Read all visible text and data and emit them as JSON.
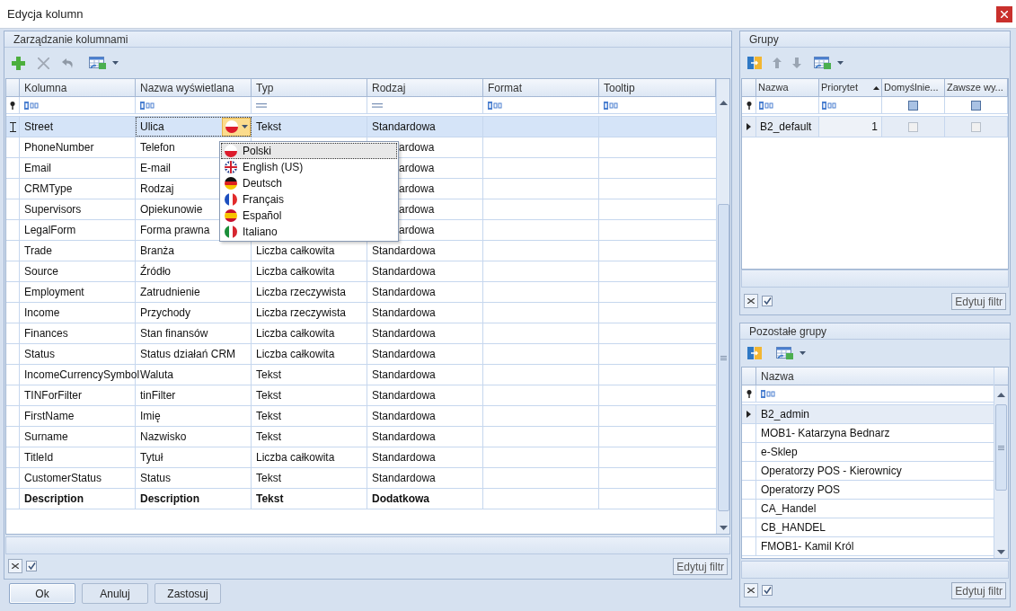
{
  "window": {
    "title": "Edycja kolumn"
  },
  "columns_panel": {
    "title": "Zarządzanie kolumnami",
    "columns": [
      {
        "label": "Kolumna",
        "kind": "text"
      },
      {
        "label": "Nazwa wyświetlana",
        "kind": "text"
      },
      {
        "label": "Typ",
        "kind": "equals"
      },
      {
        "label": "Rodzaj",
        "kind": "equals"
      },
      {
        "label": "Format",
        "kind": "text"
      },
      {
        "label": "Tooltip",
        "kind": "text"
      }
    ],
    "rows": [
      {
        "kolumna": "Street",
        "nazwa": "Ulica",
        "typ": "Tekst",
        "rodzaj": "Standardowa",
        "selected": true,
        "editing": true,
        "kind": "standard"
      },
      {
        "kolumna": "PhoneNumber",
        "nazwa": "Telefon",
        "rodzaj": "ardowa",
        "selected": false,
        "editing": false,
        "kind": "standard"
      },
      {
        "kolumna": "Email",
        "nazwa": "E-mail",
        "rodzaj": "ardowa",
        "selected": false,
        "editing": false,
        "kind": "standard"
      },
      {
        "kolumna": "CRMType",
        "nazwa": "Rodzaj",
        "rodzaj": "ardowa",
        "selected": false,
        "editing": false,
        "kind": "standard"
      },
      {
        "kolumna": "Supervisors",
        "nazwa": "Opiekunowie",
        "rodzaj": "ardowa",
        "selected": false,
        "editing": false,
        "kind": "standard"
      },
      {
        "kolumna": "LegalForm",
        "nazwa": "Forma prawna",
        "rodzaj": "ardowa",
        "selected": false,
        "editing": false,
        "kind": "standard"
      },
      {
        "kolumna": "Trade",
        "nazwa": "Branża",
        "typ": "Liczba całkowita",
        "rodzaj": "Standardowa",
        "selected": false,
        "editing": false,
        "kind": "standard"
      },
      {
        "kolumna": "Source",
        "nazwa": "Źródło",
        "typ": "Liczba całkowita",
        "rodzaj": "Standardowa",
        "selected": false,
        "editing": false,
        "kind": "standard"
      },
      {
        "kolumna": "Employment",
        "nazwa": "Zatrudnienie",
        "typ": "Liczba rzeczywista",
        "rodzaj": "Standardowa",
        "selected": false,
        "editing": false,
        "kind": "standard"
      },
      {
        "kolumna": "Income",
        "nazwa": "Przychody",
        "typ": "Liczba rzeczywista",
        "rodzaj": "Standardowa",
        "selected": false,
        "editing": false,
        "kind": "standard"
      },
      {
        "kolumna": "Finances",
        "nazwa": "Stan finansów",
        "typ": "Liczba całkowita",
        "rodzaj": "Standardowa",
        "selected": false,
        "editing": false,
        "kind": "standard"
      },
      {
        "kolumna": "Status",
        "nazwa": "Status działań CRM",
        "typ": "Liczba całkowita",
        "rodzaj": "Standardowa",
        "selected": false,
        "editing": false,
        "kind": "standard"
      },
      {
        "kolumna": "IncomeCurrencySymbol",
        "nazwa": "Waluta",
        "typ": "Tekst",
        "rodzaj": "Standardowa",
        "selected": false,
        "editing": false,
        "kind": "standard"
      },
      {
        "kolumna": "TINForFilter",
        "nazwa": "tinFilter",
        "typ": "Tekst",
        "rodzaj": "Standardowa",
        "selected": false,
        "editing": false,
        "kind": "standard"
      },
      {
        "kolumna": "FirstName",
        "nazwa": "Imię",
        "typ": "Tekst",
        "rodzaj": "Standardowa",
        "selected": false,
        "editing": false,
        "kind": "standard"
      },
      {
        "kolumna": "Surname",
        "nazwa": "Nazwisko",
        "typ": "Tekst",
        "rodzaj": "Standardowa",
        "selected": false,
        "editing": false,
        "kind": "standard"
      },
      {
        "kolumna": "TitleId",
        "nazwa": "Tytuł",
        "typ": "Liczba całkowita",
        "rodzaj": "Standardowa",
        "selected": false,
        "editing": false,
        "kind": "standard"
      },
      {
        "kolumna": "CustomerStatus",
        "nazwa": "Status",
        "typ": "Tekst",
        "rodzaj": "Standardowa",
        "selected": false,
        "editing": false,
        "kind": "standard"
      },
      {
        "kolumna": "Description",
        "nazwa": "Description",
        "typ": "Tekst",
        "rodzaj": "Dodatkowa",
        "selected": false,
        "editing": false,
        "kind": "custom"
      }
    ],
    "language_menu": {
      "items": [
        {
          "label": "Polski",
          "kind": "pl",
          "selected": true
        },
        {
          "label": "English (US)",
          "kind": "gb",
          "selected": false
        },
        {
          "label": "Deutsch",
          "kind": "de",
          "selected": false
        },
        {
          "label": "Français",
          "kind": "fr",
          "selected": false
        },
        {
          "label": "Español",
          "kind": "es",
          "selected": false
        },
        {
          "label": "Italiano",
          "kind": "it",
          "selected": false
        }
      ]
    },
    "filter_bar": {
      "checked": true,
      "button": "Edytuj filtr"
    }
  },
  "groups_panel": {
    "title": "Grupy",
    "columns": [
      {
        "label": "Nazwa",
        "kind": "text",
        "sorted": false
      },
      {
        "label": "Priorytet",
        "kind": "text",
        "sorted": true
      },
      {
        "label": "Domyślnie...",
        "kind": "checkbox",
        "sorted": false
      },
      {
        "label": "Zawsze wy...",
        "kind": "checkbox",
        "sorted": false
      }
    ],
    "rows": [
      {
        "name": "B2_default",
        "priority": "1",
        "default": false,
        "always": false,
        "selected": true
      }
    ],
    "filter_bar": {
      "checked": true,
      "button": "Edytuj filtr"
    }
  },
  "other_groups_panel": {
    "title": "Pozostałe grupy",
    "columns": [
      {
        "label": "Nazwa",
        "kind": "text"
      }
    ],
    "rows": [
      {
        "name": "B2_admin",
        "selected": true
      },
      {
        "name": "MOB1- Katarzyna Bednarz",
        "selected": false
      },
      {
        "name": "e-Sklep",
        "selected": false
      },
      {
        "name": "Operatorzy POS - Kierownicy",
        "selected": false
      },
      {
        "name": "Operatorzy POS",
        "selected": false
      },
      {
        "name": "CA_Handel",
        "selected": false
      },
      {
        "name": "CB_HANDEL",
        "selected": false
      },
      {
        "name": "FMOB1- Kamil Król",
        "selected": false
      }
    ],
    "filter_bar": {
      "checked": true,
      "button": "Edytuj filtr"
    }
  },
  "buttons": [
    {
      "label": "Ok",
      "default": true
    },
    {
      "label": "Anuluj",
      "default": false
    },
    {
      "label": "Zastosuj",
      "default": false
    }
  ]
}
